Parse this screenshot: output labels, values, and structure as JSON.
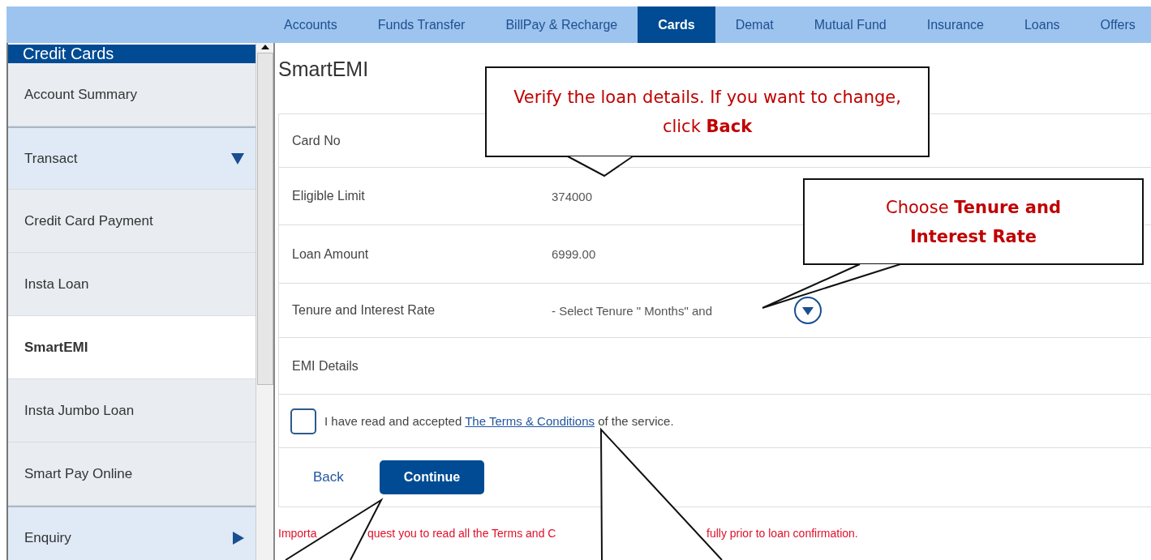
{
  "nav": {
    "tabs": [
      {
        "label": "Accounts",
        "selected": false
      },
      {
        "label": "Funds Transfer",
        "selected": false
      },
      {
        "label": "BillPay & Recharge",
        "selected": false
      },
      {
        "label": "Cards",
        "selected": true
      },
      {
        "label": "Demat",
        "selected": false
      },
      {
        "label": "Mutual Fund",
        "selected": false
      },
      {
        "label": "Insurance",
        "selected": false
      },
      {
        "label": "Loans",
        "selected": false
      },
      {
        "label": "Offers",
        "selected": false
      }
    ]
  },
  "sidebar": {
    "title": "Credit Cards",
    "items": [
      {
        "label": "Account Summary",
        "kind": "link",
        "selected": false
      },
      {
        "label": "Transact",
        "kind": "section",
        "expanded": true
      },
      {
        "label": "Credit Card Payment",
        "kind": "link",
        "selected": false
      },
      {
        "label": "Insta Loan",
        "kind": "link",
        "selected": false
      },
      {
        "label": "SmartEMI",
        "kind": "link",
        "selected": true
      },
      {
        "label": "Insta Jumbo Loan",
        "kind": "link",
        "selected": false
      },
      {
        "label": "Smart Pay Online",
        "kind": "link",
        "selected": false
      },
      {
        "label": "Enquiry",
        "kind": "section",
        "expanded": false
      }
    ]
  },
  "page": {
    "title": "SmartEMI"
  },
  "form": {
    "rows": [
      {
        "label": "Card No",
        "kind": "text"
      },
      {
        "label": "Eligible Limit",
        "kind": "text",
        "value": "374000"
      },
      {
        "label": "Loan Amount",
        "kind": "text",
        "value": "6999.00"
      },
      {
        "label": "Tenure and Interest Rate",
        "kind": "select",
        "value": "- Select Tenure \" Months\" and"
      },
      {
        "label": "EMI Details",
        "kind": "text"
      }
    ]
  },
  "terms": {
    "checked": false,
    "text_before": "I have read and accepted",
    "link": "The Terms & Conditions",
    "text_after": "of the service."
  },
  "buttons": [
    {
      "label": "Back",
      "kind": "link"
    },
    {
      "label": "Continue",
      "kind": "primary"
    }
  ],
  "notice": [
    "Importa",
    "quest you to read all the Terms and C",
    "fully prior to loan confirmation."
  ],
  "callouts": [
    {
      "text": "Verify the loan details. If you want to change, click **Back**"
    },
    {
      "text": "Choose **Tenure and Interest Rate**"
    }
  ]
}
